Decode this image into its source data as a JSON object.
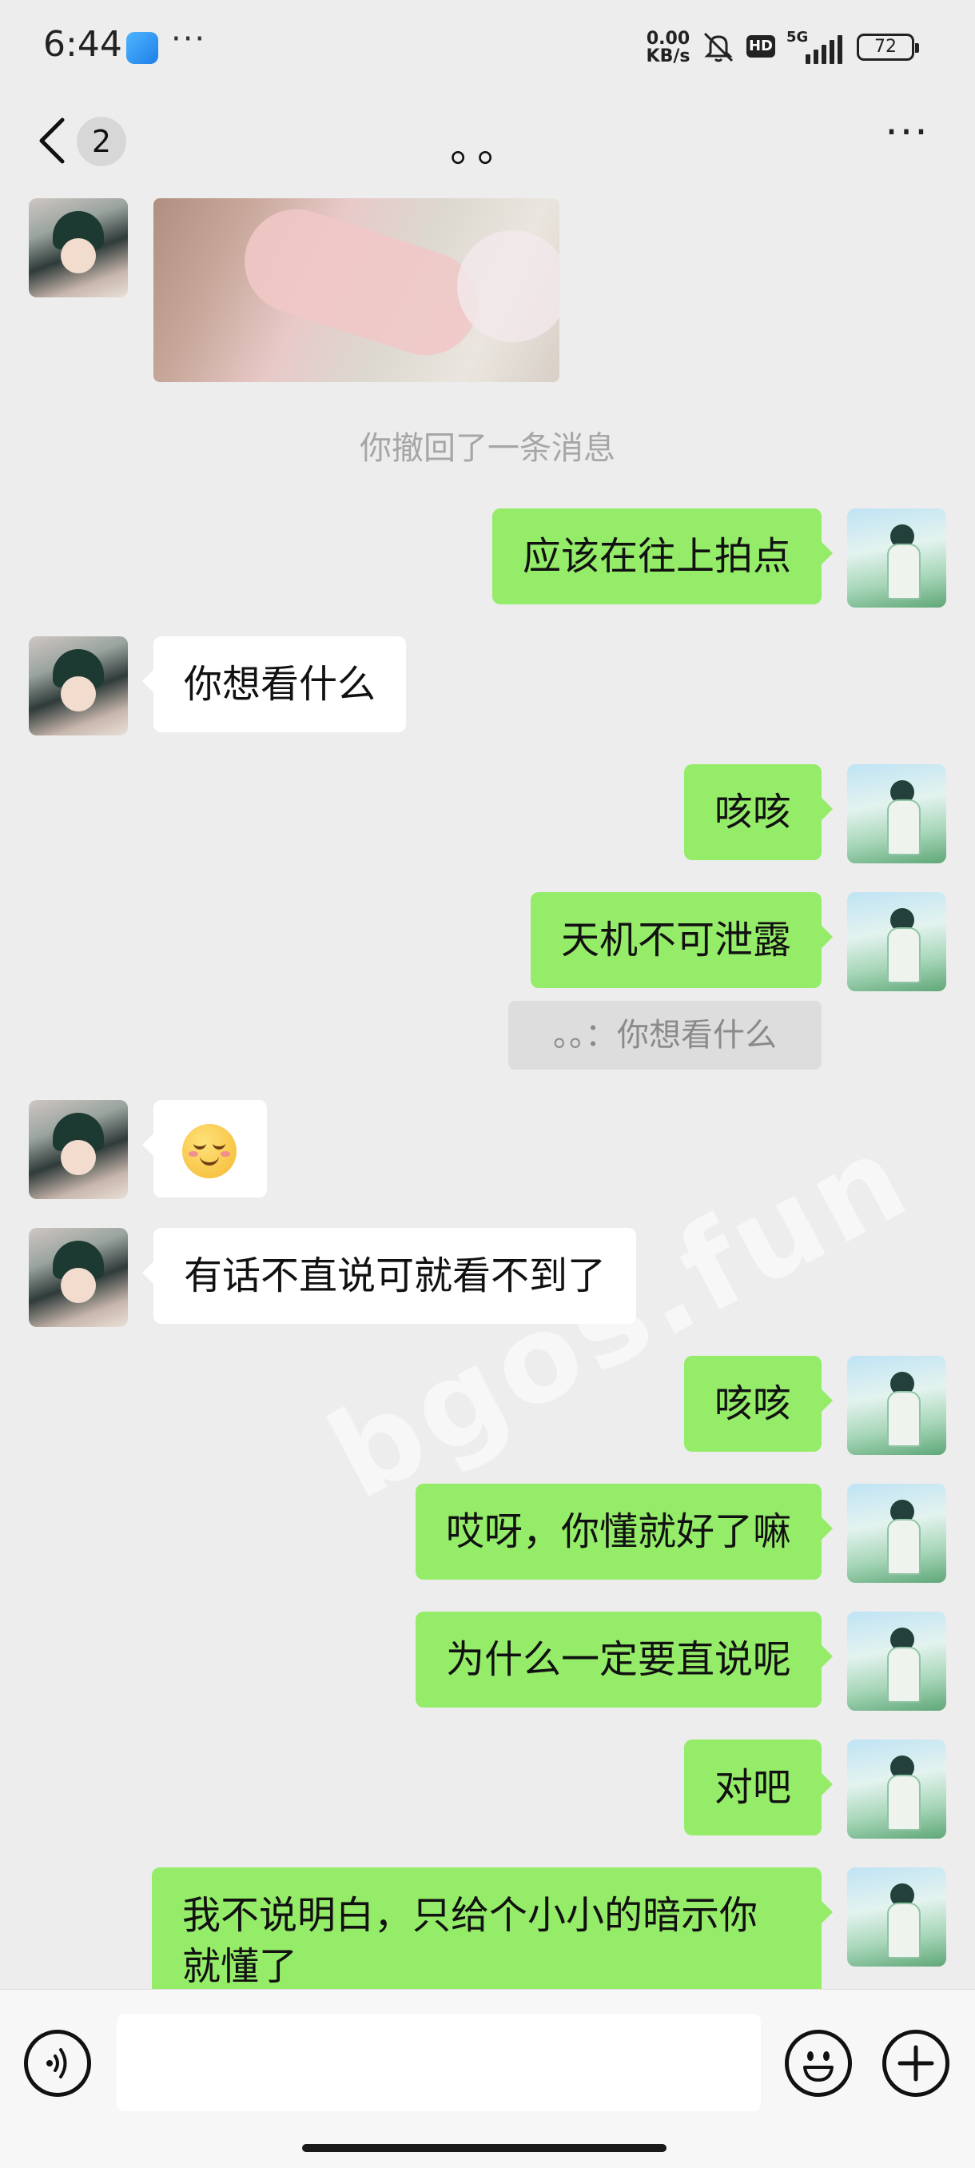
{
  "status_bar": {
    "time": "6:44",
    "menu_dots": "···",
    "speed_value": "0.00",
    "speed_unit": "KB/s",
    "hd": "HD",
    "network": "5G",
    "battery": "72"
  },
  "header": {
    "unread_count": "2",
    "title": "。。",
    "more": "···"
  },
  "messages": [
    {
      "side": "them",
      "type": "image"
    },
    {
      "type": "system",
      "text": "你撤回了一条消息"
    },
    {
      "side": "me",
      "text": "应该在往上拍点"
    },
    {
      "side": "them",
      "text": "你想看什么"
    },
    {
      "side": "me",
      "text": "咳咳"
    },
    {
      "side": "me",
      "text": "天机不可泄露",
      "quote": "。。：你想看什么"
    },
    {
      "side": "them",
      "type": "emoji",
      "emoji_name": "shy-smile-emoji"
    },
    {
      "side": "them",
      "text": "有话不直说可就看不到了"
    },
    {
      "side": "me",
      "text": "咳咳"
    },
    {
      "side": "me",
      "text": "哎呀，你懂就好了嘛"
    },
    {
      "side": "me",
      "text": "为什么一定要直说呢"
    },
    {
      "side": "me",
      "text": "对吧"
    },
    {
      "side": "me",
      "text": "我不说明白，只给个小小的暗示你就懂了"
    }
  ],
  "watermark": "bgos.fun",
  "input_bar": {
    "icons": [
      "voice-icon",
      "emoji-icon",
      "plus-icon"
    ]
  },
  "colors": {
    "background": "#ededed",
    "my_bubble": "#95ec69",
    "their_bubble": "#ffffff"
  }
}
